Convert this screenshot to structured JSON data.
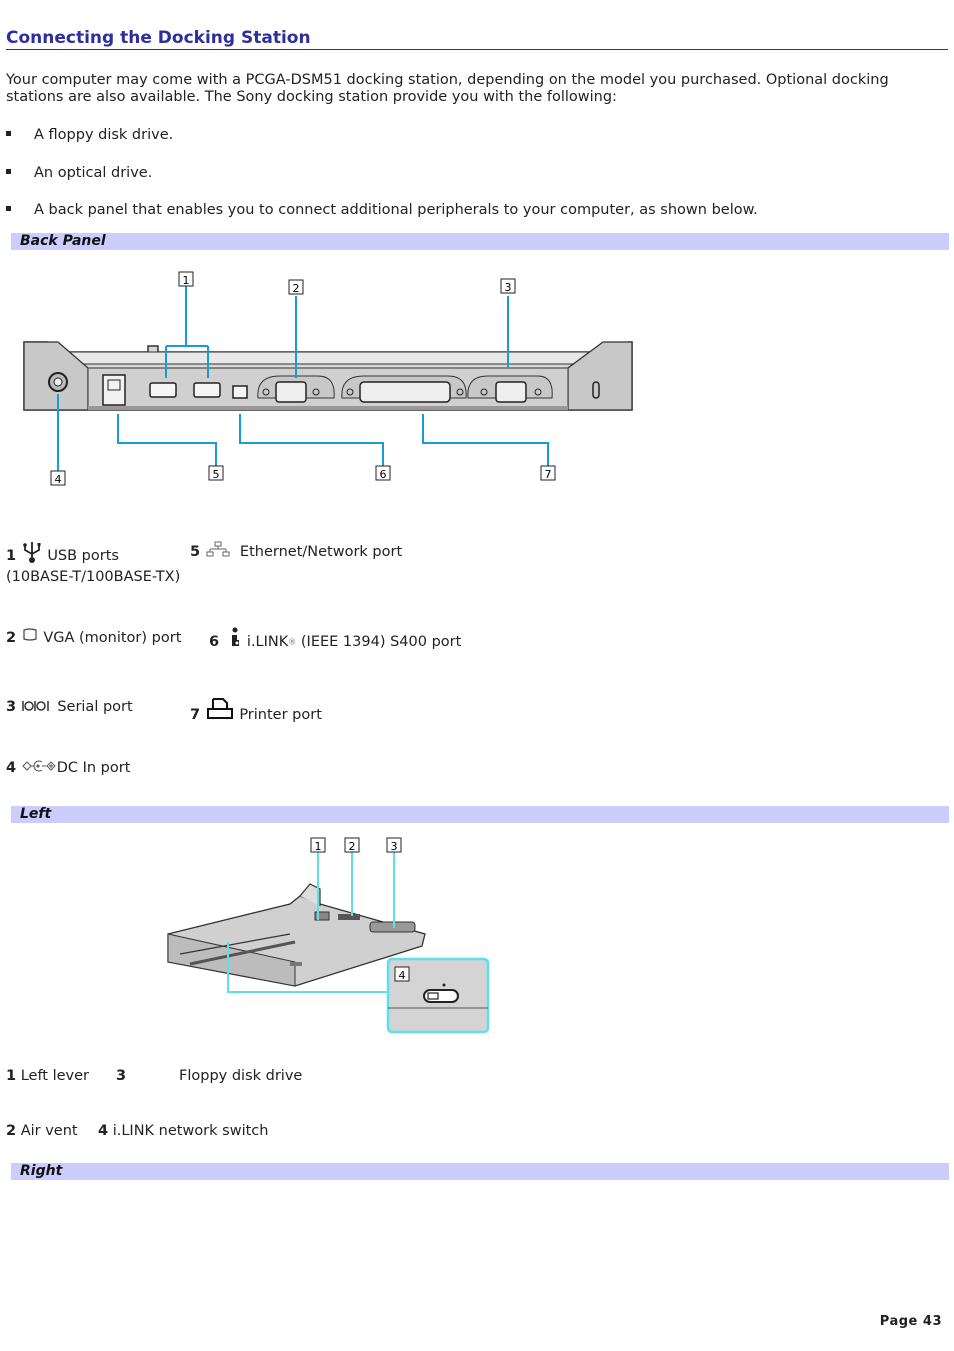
{
  "title": "Connecting the Docking Station",
  "intro": "Your computer may come with a PCGA-DSM51 docking station, depending on the model you purchased. Optional docking stations are also available. The Sony docking station provide you with the following:",
  "bullets": [
    "A floppy disk drive.",
    "An optical drive.",
    "A back panel that enables you to connect additional peripherals to your computer, as shown below."
  ],
  "sections": {
    "back_panel": {
      "heading": "Back Panel",
      "callouts": [
        "1",
        "2",
        "3",
        "4",
        "5",
        "6",
        "7"
      ],
      "legend": [
        {
          "num": "1",
          "icon": "usb-icon",
          "label": "USB ports"
        },
        {
          "num": "5",
          "icon": "network-icon",
          "label": "Ethernet/Network port",
          "sublabel": "(10BASE-T/100BASE-TX)"
        },
        {
          "num": "2",
          "icon": "monitor-icon",
          "label": "VGA (monitor) port"
        },
        {
          "num": "6",
          "icon": "ilink-icon",
          "label": "i.LINK",
          "reg": "®",
          "label_rest": " (IEEE 1394) S400 port"
        },
        {
          "num": "3",
          "icon": "serial-icon",
          "label": "Serial port"
        },
        {
          "num": "7",
          "icon": "printer-icon",
          "label": "Printer port"
        },
        {
          "num": "4",
          "icon": "dc-in-icon",
          "label": "DC In port"
        }
      ]
    },
    "left": {
      "heading": "Left",
      "callouts": [
        "1",
        "2",
        "3",
        "4"
      ],
      "legend": [
        {
          "num": "1",
          "label": "Left lever"
        },
        {
          "num": "3",
          "label": "Floppy disk drive"
        },
        {
          "num": "2",
          "label": "Air vent"
        },
        {
          "num": "4",
          "label": "i.LINK network switch"
        }
      ]
    },
    "right": {
      "heading": "Right"
    }
  },
  "footer": {
    "page": "Page 43"
  },
  "colors": {
    "title": "#2e2e9e",
    "section_bar": "#ccccff",
    "callout_line_back": "#1a9ad6",
    "callout_line_left": "#5ee0e8"
  }
}
